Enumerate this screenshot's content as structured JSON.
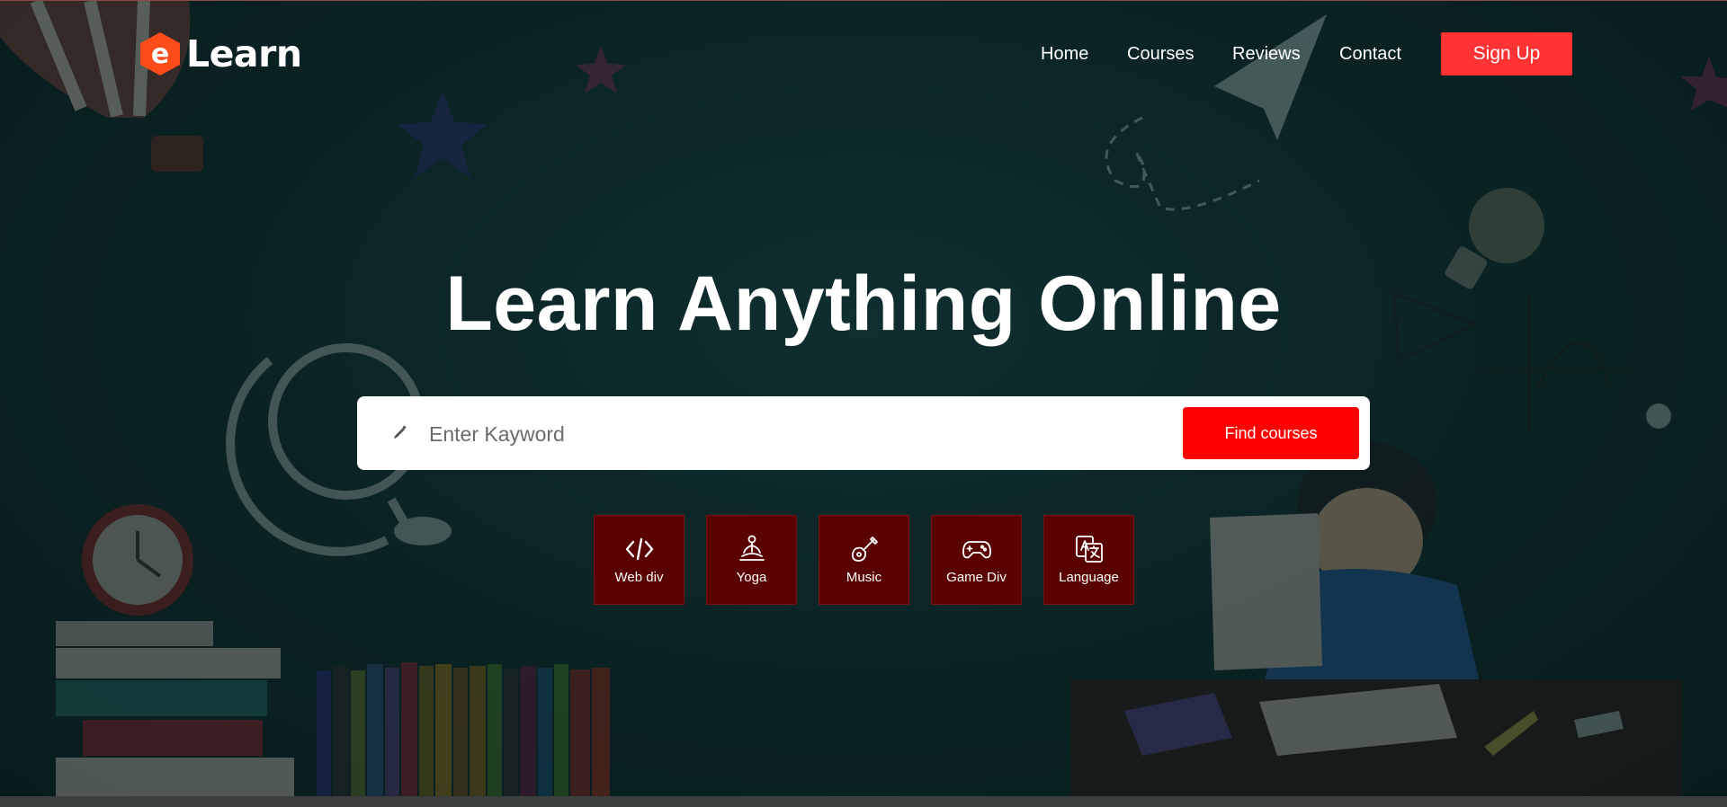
{
  "header": {
    "logo": {
      "mark": "e",
      "text": "Learn",
      "accent": "#ff4d1a"
    },
    "nav": [
      {
        "label": "Home"
      },
      {
        "label": "Courses"
      },
      {
        "label": "Reviews"
      },
      {
        "label": "Contact"
      }
    ],
    "signup_label": "Sign Up",
    "signup_color": "#ff3333"
  },
  "hero": {
    "title": "Learn Anything Online",
    "search": {
      "icon": "pencil-icon",
      "placeholder": "Enter Kayword",
      "value": "",
      "button_label": "Find courses",
      "button_color": "#ff0000"
    },
    "categories": [
      {
        "label": "Web div",
        "icon": "code-icon"
      },
      {
        "label": "Yoga",
        "icon": "yoga-icon"
      },
      {
        "label": "Music",
        "icon": "guitar-icon"
      },
      {
        "label": "Game Div",
        "icon": "gamepad-icon"
      },
      {
        "label": "Language",
        "icon": "translate-icon"
      }
    ],
    "category_color": "#5a0202"
  },
  "colors": {
    "background": "#0f2a2b",
    "text": "#ffffff"
  }
}
